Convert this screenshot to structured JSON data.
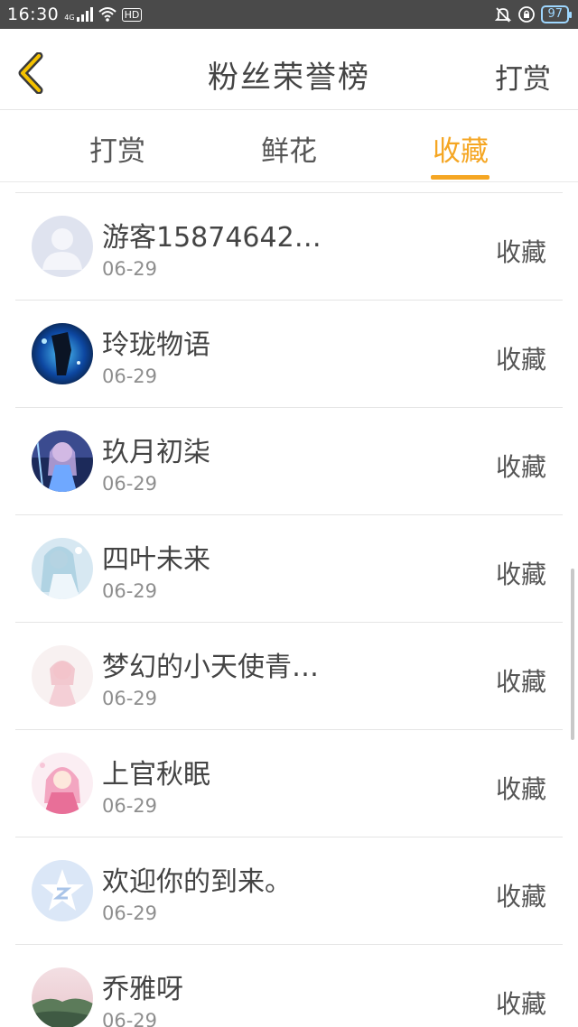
{
  "status_bar": {
    "time": "16:30",
    "network": "4G",
    "hd": "HD",
    "battery": "97"
  },
  "header": {
    "title": "粉丝荣誉榜",
    "action_label": "打赏"
  },
  "tabs": [
    {
      "label": "打赏",
      "active": false
    },
    {
      "label": "鲜花",
      "active": false
    },
    {
      "label": "收藏",
      "active": true
    }
  ],
  "accent_color": "#f5a623",
  "list": {
    "items": [
      {
        "name": "游客15874642…",
        "date": "06-29",
        "action": "收藏",
        "avatar": "default-user"
      },
      {
        "name": "玲珑物语",
        "date": "06-29",
        "action": "收藏",
        "avatar": "dark-blue-figure"
      },
      {
        "name": "玖月初柒",
        "date": "06-29",
        "action": "收藏",
        "avatar": "anime-blue-girl"
      },
      {
        "name": "四叶未来",
        "date": "06-29",
        "action": "收藏",
        "avatar": "anime-light-blue"
      },
      {
        "name": "梦幻的小天使青…",
        "date": "06-29",
        "action": "收藏",
        "avatar": "anime-pink-pale"
      },
      {
        "name": "上官秋眠",
        "date": "06-29",
        "action": "收藏",
        "avatar": "anime-pink-girl"
      },
      {
        "name": "欢迎你的到来。",
        "date": "06-29",
        "action": "收藏",
        "avatar": "qq-star"
      },
      {
        "name": "乔雅呀",
        "date": "06-29",
        "action": "收藏",
        "avatar": "landscape"
      }
    ]
  }
}
